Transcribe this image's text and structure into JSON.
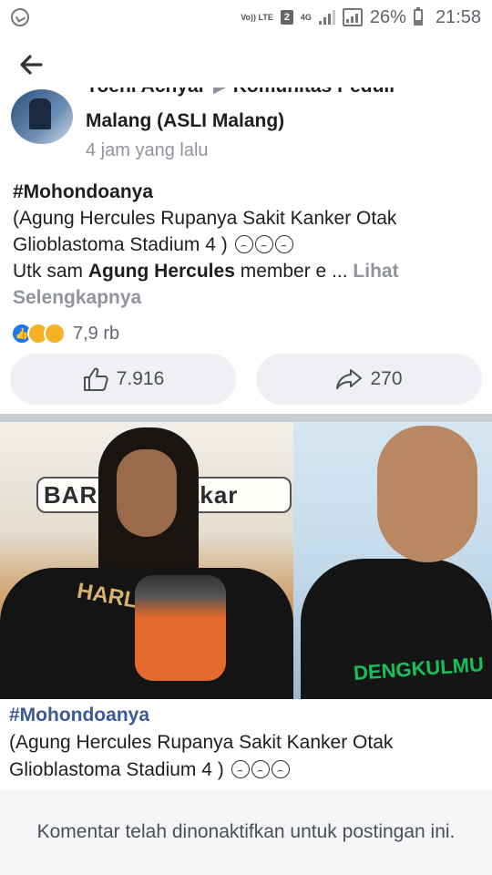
{
  "status_bar": {
    "whatsapp_icon": "whatsapp-icon",
    "volte_label": "Vo)) LTE",
    "sim_label": "2",
    "network_label": "4G",
    "battery_percent": "26%",
    "time": "21:58"
  },
  "header": {
    "back_icon": "arrow-left-icon"
  },
  "post": {
    "author_name": "Yoeni Achyar",
    "group_name_line1": "Komunitas Peduli",
    "group_name_line2": "Malang (ASLI Malang)",
    "time": "4 jam yang lalu",
    "hashtag": "#Mohondoanya",
    "text_line": "(Agung Hercules Rupanya Sakit Kanker Otak Glioblastoma Stadium 4 )",
    "text_line2_pre": "Utk sam ",
    "text_line2_bold": "Agung Hercules",
    "text_line2_post": " member e ...",
    "see_more": "Lihat Selengkapnya",
    "reactions_count": "7,9 rb",
    "like_count": "7.916",
    "share_count": "270"
  },
  "image": {
    "left_banner_text": "BARB   oel Bakar",
    "left_shirt_text": "HARLEY",
    "right_shirt_text": "DENGKULMU"
  },
  "caption": {
    "hashtag": "#Mohondoanya",
    "text": "(Agung Hercules Rupanya Sakit Kanker Otak Glioblastoma Stadium 4 )"
  },
  "footer": {
    "message": "Komentar telah dinonaktifkan untuk postingan ini."
  },
  "colors": {
    "like_blue": "#1877f2",
    "caption_tag": "#3b5998",
    "muted_text": "#90949c"
  }
}
